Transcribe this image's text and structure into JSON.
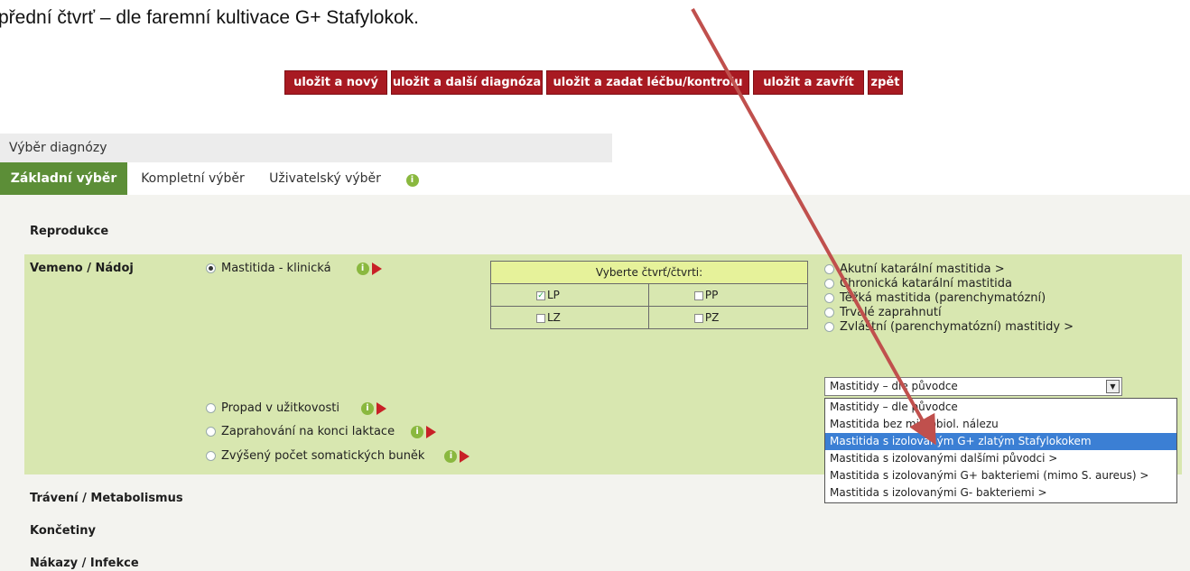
{
  "doc_text": "přední čtvrť – dle faremní kultivace G+ Stafylokok.",
  "toolbar": {
    "buttons": [
      {
        "label": "uložit a nový"
      },
      {
        "label": "uložit a další diagnóza"
      },
      {
        "label": "uložit a zadat léčbu/kontrolu"
      },
      {
        "label": "uložit a zavřít"
      },
      {
        "label": "zpět"
      }
    ]
  },
  "section_title": "Výběr diagnózy",
  "tabs": [
    "Základní výběr",
    "Kompletní výběr",
    "Uživatelský výběr"
  ],
  "categories": {
    "reprodukce": "Reprodukce",
    "vemeno": "Vemeno / Nádoj",
    "traveni": "Trávení / Metabolismus",
    "koncetiny": "Končetiny",
    "nakazy": "Nákazy / Infekce"
  },
  "vemeno_options": [
    {
      "label": "Mastitida - klinická",
      "selected": true
    },
    {
      "label": "Propad v užitkovosti",
      "selected": false
    },
    {
      "label": "Zaprahování na konci laktace",
      "selected": false
    },
    {
      "label": "Zvýšený počet somatických buněk",
      "selected": false
    }
  ],
  "quarters": {
    "header": "Vyberte čtvrť/čtvrti:",
    "cells": [
      {
        "label": "LP",
        "checked": true
      },
      {
        "label": "PP",
        "checked": false
      },
      {
        "label": "LZ",
        "checked": false
      },
      {
        "label": "PZ",
        "checked": false
      }
    ]
  },
  "diagnoses": [
    "Akutní katarální mastitida >",
    "Chronická katarální mastitida",
    "Těžká mastitida (parenchymatózní)",
    "Trvalé zaprahnutí",
    "Zvláštní (parenchymatózní) mastitidy >"
  ],
  "select": {
    "value": "Mastitidy – dle původce",
    "options": [
      "Mastitidy – dle původce",
      "Mastitida bez mikrobiol. nálezu",
      "Mastitida s izolovaným G+ zlatým Stafylokokem",
      "Mastitida s izolovanými dalšími původci >",
      "Mastitida s izolovanými G+ bakteriemi (mimo S. aureus) >",
      "Mastitida s izolovanými G- bakteriemi >"
    ],
    "highlighted_index": 2
  },
  "colors": {
    "button_red": "#a81a22",
    "tab_green": "#5c8e37",
    "panel_green": "#d8e7b0",
    "highlight": "#3b7fd4",
    "arrow": "#c0504d"
  }
}
